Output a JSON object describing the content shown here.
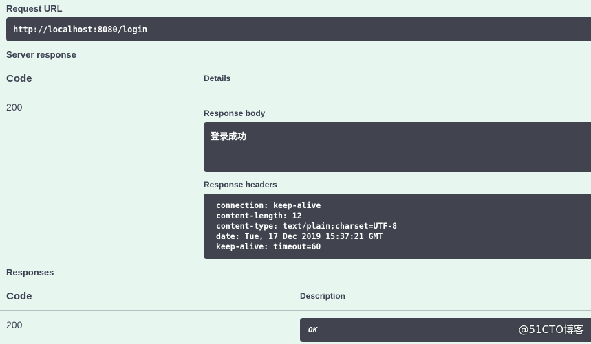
{
  "request_url": {
    "label": "Request URL",
    "value": "http://localhost:8080/login"
  },
  "server_response": {
    "label": "Server response",
    "code_header": "Code",
    "details_header": "Details",
    "code": "200",
    "response_body_label": "Response body",
    "response_body": "登录成功",
    "response_headers_label": "Response headers",
    "headers": [
      "connection: keep-alive",
      "content-length: 12",
      "content-type: text/plain;charset=UTF-8",
      "date: Tue, 17 Dec 2019 15:37:21 GMT",
      "keep-alive: timeout=60"
    ]
  },
  "responses": {
    "label": "Responses",
    "code_header": "Code",
    "description_header": "Description",
    "code": "200",
    "description": "OK"
  },
  "watermark": "@51CTO博客",
  "colors": {
    "background": "#e8f6f0",
    "block": "#41444e",
    "text": "#3b4151"
  }
}
